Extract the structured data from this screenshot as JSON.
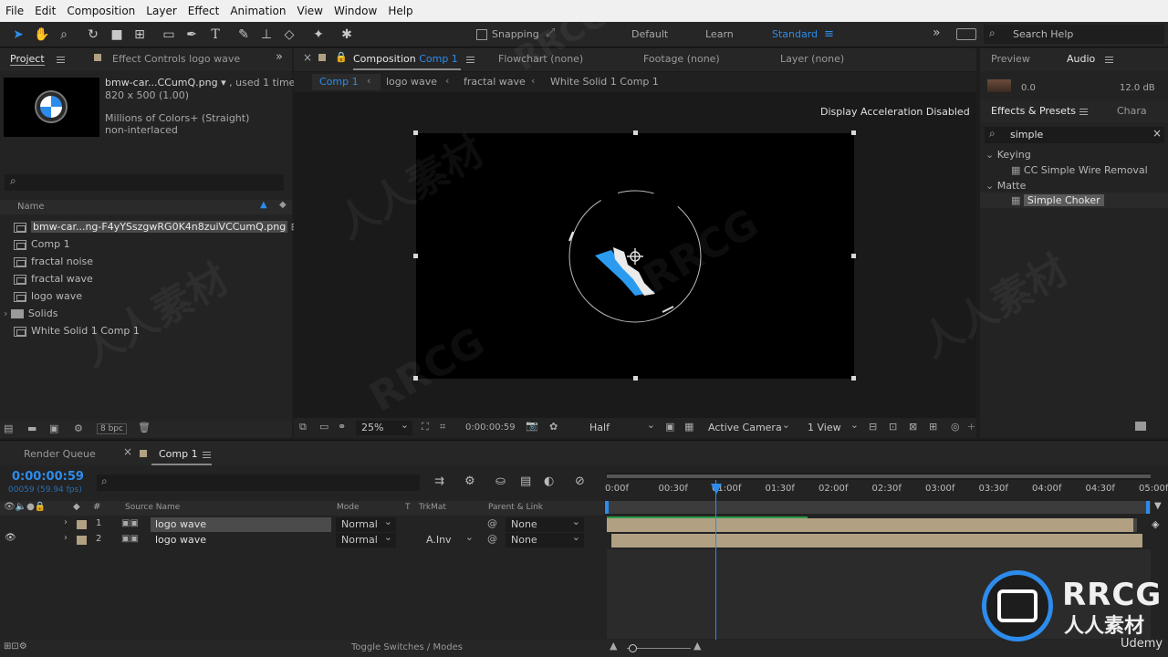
{
  "menu": [
    "File",
    "Edit",
    "Composition",
    "Layer",
    "Effect",
    "Animation",
    "View",
    "Window",
    "Help"
  ],
  "toolbar": {
    "snapping_label": "Snapping",
    "workspaces": [
      "Default",
      "Learn",
      "Standard"
    ],
    "active_workspace": "Standard",
    "search_placeholder": "Search Help"
  },
  "project_panel": {
    "tab_project": "Project",
    "tab_effect_controls": "Effect Controls logo wave",
    "preview_name": "bmw-car...CCumQ.png",
    "preview_used": ", used 1 time",
    "preview_dims": "820 x 500 (1.00)",
    "preview_colors": "Millions of Colors+ (Straight)",
    "preview_interlace": "non-interlaced",
    "column_name": "Name",
    "items": [
      {
        "label": "bmw-car...ng-F4yYSszgwRG0K4n8zuiVCCumQ.png",
        "type": "file"
      },
      {
        "label": "Comp 1",
        "type": "comp"
      },
      {
        "label": "fractal noise",
        "type": "comp"
      },
      {
        "label": "fractal wave",
        "type": "comp"
      },
      {
        "label": "logo wave",
        "type": "comp"
      },
      {
        "label": "Solids",
        "type": "folder"
      },
      {
        "label": "White Solid 1 Comp 1",
        "type": "comp"
      }
    ],
    "bpc": "8 bpc"
  },
  "composition_panel": {
    "tab_label": "Composition",
    "tab_comp": "Comp 1",
    "tab_flowchart": "Flowchart (none)",
    "tab_footage": "Footage (none)",
    "tab_layer": "Layer (none)",
    "breadcrumbs": [
      "Comp 1",
      "logo wave",
      "fractal wave",
      "White Solid 1 Comp 1"
    ],
    "notice": "Display Acceleration Disabled",
    "zoom": "25%",
    "timecode": "0:00:00:59",
    "resolution": "Half",
    "camera": "Active Camera",
    "views": "1 View"
  },
  "right_panel": {
    "tab_preview": "Preview",
    "tab_audio": "Audio",
    "audio_left": "0.0",
    "audio_right": "12.0 dB",
    "tab_effects": "Effects & Presets",
    "tab_chara": "Chara",
    "search_value": "simple",
    "groups": [
      {
        "name": "Keying",
        "items": [
          "CC Simple Wire Removal"
        ]
      },
      {
        "name": "Matte",
        "items": [
          "Simple Choker"
        ]
      }
    ]
  },
  "timeline": {
    "tab_render_queue": "Render Queue",
    "tab_comp": "Comp 1",
    "timecode": "0:00:00:59",
    "timecode_sub": "00059 (59.94 fps)",
    "columns": {
      "source": "Source Name",
      "mode": "Mode",
      "t": "T",
      "trkmat": "TrkMat",
      "parent": "Parent & Link"
    },
    "ruler": [
      "0:00f",
      "00:30f",
      "01:00f",
      "01:30f",
      "02:00f",
      "02:30f",
      "03:00f",
      "03:30f",
      "04:00f",
      "04:30f",
      "05:00f"
    ],
    "playhead": "01:00f",
    "layers": [
      {
        "num": "1",
        "name": "logo wave",
        "mode": "Normal",
        "trkmat": "",
        "parent": "None"
      },
      {
        "num": "2",
        "name": "logo wave",
        "mode": "Normal",
        "trkmat": "A.Inv",
        "parent": "None"
      }
    ],
    "footer": "Toggle Switches / Modes"
  },
  "watermarks": {
    "brand": "RRCG",
    "cn": "人人素材",
    "udemy": "Udemy"
  },
  "colors": {
    "accent": "#2d8ceb",
    "layer_bar": "#b2a083",
    "bg": "#1d1d1d"
  }
}
